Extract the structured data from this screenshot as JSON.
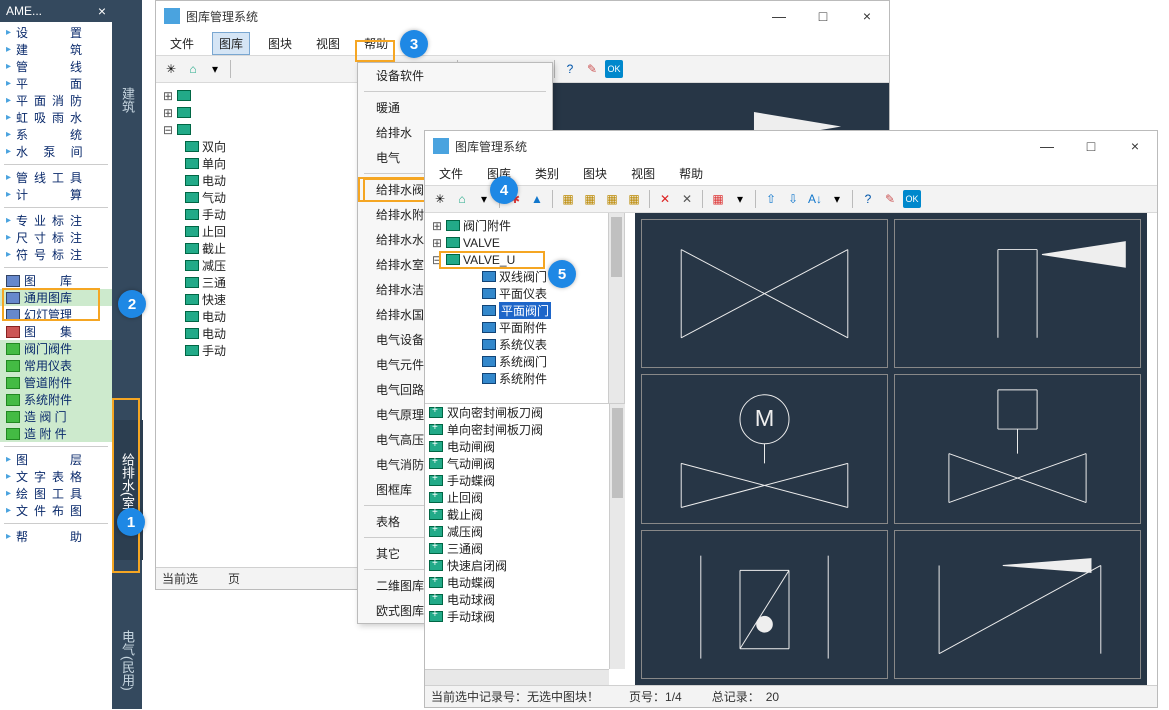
{
  "leftPalette": {
    "title": "AME...",
    "group1": [
      "设　　置",
      "建　　筑",
      "管　　线",
      "平　　面",
      "平面消防",
      "虹吸雨水",
      "系　　统",
      "水 泵 间"
    ],
    "group2": [
      "管线工具",
      "计　　算"
    ],
    "group3": [
      "专业标注",
      "尺寸标注",
      "符号标注"
    ],
    "group4": [
      {
        "label": "图　　库",
        "sel": false,
        "hl": true
      },
      {
        "label": "通用图库",
        "sel": true
      },
      {
        "label": "幻灯管理",
        "sel": false
      },
      {
        "label": "图　　集",
        "sel": false
      },
      {
        "label": "阀门阀件",
        "sel": true
      },
      {
        "label": "常用仪表",
        "sel": true
      },
      {
        "label": "管道附件",
        "sel": true
      },
      {
        "label": "系统附件",
        "sel": true
      },
      {
        "label": "造 阀 门",
        "sel": true
      },
      {
        "label": "造 附 件",
        "sel": true
      }
    ],
    "group5": [
      "图　　层",
      "文字表格",
      "绘图工具",
      "文件布图"
    ],
    "group6": [
      "帮　　助"
    ]
  },
  "vtabs": [
    "建筑",
    "给排水(室内)",
    "电气(民用)"
  ],
  "win1": {
    "title": "图库管理系统",
    "menus": [
      "文件",
      "图库",
      "图块",
      "视图",
      "帮助"
    ],
    "treeItems": [
      "双向",
      "单向",
      "电动",
      "气动",
      "手动",
      "止回",
      "截止",
      "减压",
      "三通",
      "快速",
      "电动",
      "电动",
      "手动"
    ],
    "statusPrefix": "当前选"
  },
  "dropdown": {
    "groups": [
      [
        "设备软件"
      ],
      [
        "暖通",
        "给排水",
        "电气"
      ],
      [
        "给排水阀门库",
        "给排水附件库",
        "给排水水泵库",
        "给排水室外库",
        "给排水洁具库",
        "给排水国标库",
        "电气设备库",
        "电气元件库",
        "电气回路库",
        "电气原理库",
        "电气高压短路库",
        "电气消防图库",
        "图框库"
      ],
      [
        "表格"
      ],
      [
        "其它"
      ],
      [
        "二维图库",
        "欧式图库"
      ]
    ],
    "hlIndex": 0
  },
  "win2": {
    "title": "图库管理系统",
    "menus": [
      "文件",
      "图库",
      "类别",
      "图块",
      "视图",
      "帮助"
    ],
    "tree": [
      {
        "exp": "⊞",
        "label": "阀门附件",
        "cls": ""
      },
      {
        "exp": "⊞",
        "label": "VALVE",
        "cls": ""
      },
      {
        "exp": "⊟",
        "label": "VALVE_U",
        "cls": "",
        "hl": true
      },
      {
        "exp": "",
        "label": "双线阀门",
        "cls": "ind2"
      },
      {
        "exp": "",
        "label": "平面仪表",
        "cls": "ind2"
      },
      {
        "exp": "",
        "label": "平面阀门",
        "cls": "ind2 sel"
      },
      {
        "exp": "",
        "label": "平面附件",
        "cls": "ind2"
      },
      {
        "exp": "",
        "label": "系统仪表",
        "cls": "ind2"
      },
      {
        "exp": "",
        "label": "系统阀门",
        "cls": "ind2"
      },
      {
        "exp": "",
        "label": "系统附件",
        "cls": "ind2"
      }
    ],
    "bottomList": [
      "双向密封闸板刀阀",
      "单向密封闸板刀阀",
      "电动闸阀",
      "气动闸阀",
      "手动蝶阀",
      "止回阀",
      "截止阀",
      "减压阀",
      "三通阀",
      "快速启闭阀",
      "电动蝶阀",
      "电动球阀",
      "手动球阀"
    ],
    "status": {
      "sel": "当前选中记录号：无选中图块！",
      "page": "页号：1/4",
      "total": "总记录：　20"
    }
  },
  "annotations": [
    "1",
    "2",
    "3",
    "4",
    "5"
  ]
}
